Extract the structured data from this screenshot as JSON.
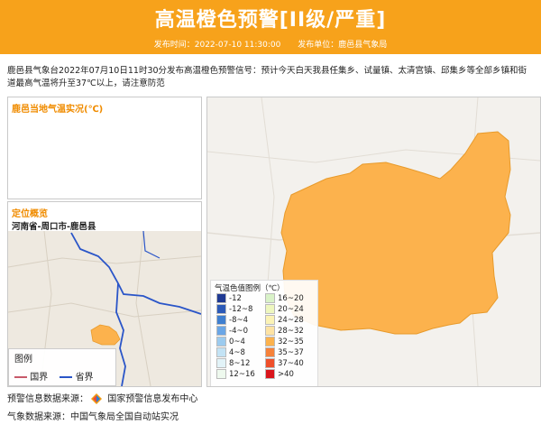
{
  "header": {
    "title": "高温橙色预警[II级/严重]",
    "publish_time_label": "发布时间：2022-07-10 11:30:00",
    "publish_unit_label": "发布单位：鹿邑县气象局",
    "bg_color": "#f7a21b"
  },
  "description": "鹿邑县气象台2022年07月10日11时30分发布高温橙色预警信号：预计今天白天我县任集乡、试量镇、太清宫镇、邱集乡等全部乡镇和街道最高气温将升至37℃以上，请注意防范",
  "temp_panel": {
    "title": "鹿邑当地气温实况(℃)"
  },
  "location_panel": {
    "title": "定位概览",
    "region": "河南省-周口市-鹿邑县",
    "legend_title": "图例",
    "legend_items": [
      {
        "label": "国界",
        "color": "#c85a6a"
      },
      {
        "label": "省界",
        "color": "#2a55c8"
      }
    ]
  },
  "big_map": {
    "region_color": "#fcb24d",
    "legend_title": "气温色值图例（℃）",
    "legend": [
      {
        "label": "-12",
        "color": "#1f3a93"
      },
      {
        "label": "-12~8",
        "color": "#2c5ab8"
      },
      {
        "label": "-8~4",
        "color": "#3f7fd0"
      },
      {
        "label": "-4~0",
        "color": "#6aa6e6"
      },
      {
        "label": "0~4",
        "color": "#9ccbef"
      },
      {
        "label": "4~8",
        "color": "#c3e3f5"
      },
      {
        "label": "8~12",
        "color": "#e2f3f8"
      },
      {
        "label": "12~16",
        "color": "#eef9ee"
      },
      {
        "label": "16~20",
        "color": "#d9f2c8"
      },
      {
        "label": "20~24",
        "color": "#eef7bf"
      },
      {
        "label": "24~28",
        "color": "#fbf3b6"
      },
      {
        "label": "28~32",
        "color": "#fde3a4"
      },
      {
        "label": "32~35",
        "color": "#fcb24d"
      },
      {
        "label": "35~37",
        "color": "#f6823a"
      },
      {
        "label": "37~40",
        "color": "#ee4f2a"
      },
      {
        "label": ">40",
        "color": "#d9151b"
      }
    ]
  },
  "footer": {
    "warning_source": "预警信息数据来源：",
    "warning_source_name": "国家预警信息发布中心",
    "weather_source": "气象数据来源：中国气象局全国自动站实况"
  }
}
